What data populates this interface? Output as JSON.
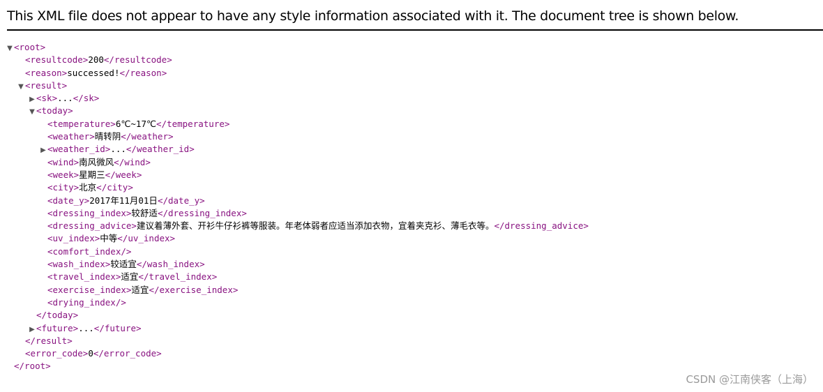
{
  "header": {
    "notice": "This XML file does not appear to have any style information associated with it. The document tree is shown below."
  },
  "tree": {
    "lines": [
      {
        "depth": 0,
        "toggle": "expanded",
        "open": "<root>",
        "value": "",
        "close": ""
      },
      {
        "depth": 1,
        "toggle": "",
        "open": "<resultcode>",
        "value": "200",
        "close": "</resultcode>"
      },
      {
        "depth": 1,
        "toggle": "",
        "open": "<reason>",
        "value": "successed!",
        "close": "</reason>"
      },
      {
        "depth": 1,
        "toggle": "expanded",
        "open": "<result>",
        "value": "",
        "close": ""
      },
      {
        "depth": 2,
        "toggle": "collapsed",
        "open": "<sk>",
        "value": "...",
        "close": "</sk>"
      },
      {
        "depth": 2,
        "toggle": "expanded",
        "open": "<today>",
        "value": "",
        "close": ""
      },
      {
        "depth": 3,
        "toggle": "",
        "open": "<temperature>",
        "value": "6℃~17℃",
        "close": "</temperature>"
      },
      {
        "depth": 3,
        "toggle": "",
        "open": "<weather>",
        "value": "晴转阴",
        "close": "</weather>"
      },
      {
        "depth": 3,
        "toggle": "collapsed",
        "open": "<weather_id>",
        "value": "...",
        "close": "</weather_id>"
      },
      {
        "depth": 3,
        "toggle": "",
        "open": "<wind>",
        "value": "南风微风",
        "close": "</wind>"
      },
      {
        "depth": 3,
        "toggle": "",
        "open": "<week>",
        "value": "星期三",
        "close": "</week>"
      },
      {
        "depth": 3,
        "toggle": "",
        "open": "<city>",
        "value": "北京",
        "close": "</city>"
      },
      {
        "depth": 3,
        "toggle": "",
        "open": "<date_y>",
        "value": "2017年11月01日",
        "close": "</date_y>"
      },
      {
        "depth": 3,
        "toggle": "",
        "open": "<dressing_index>",
        "value": "较舒适",
        "close": "</dressing_index>"
      },
      {
        "depth": 3,
        "toggle": "",
        "open": "<dressing_advice>",
        "value": "建议着薄外套、开衫牛仔衫裤等服装。年老体弱者应适当添加衣物，宜着夹克衫、薄毛衣等。",
        "close": "</dressing_advice>"
      },
      {
        "depth": 3,
        "toggle": "",
        "open": "<uv_index>",
        "value": "中等",
        "close": "</uv_index>"
      },
      {
        "depth": 3,
        "toggle": "",
        "open": "<comfort_index/>",
        "value": "",
        "close": ""
      },
      {
        "depth": 3,
        "toggle": "",
        "open": "<wash_index>",
        "value": "较适宜",
        "close": "</wash_index>"
      },
      {
        "depth": 3,
        "toggle": "",
        "open": "<travel_index>",
        "value": "适宜",
        "close": "</travel_index>"
      },
      {
        "depth": 3,
        "toggle": "",
        "open": "<exercise_index>",
        "value": "适宜",
        "close": "</exercise_index>"
      },
      {
        "depth": 3,
        "toggle": "",
        "open": "<drying_index/>",
        "value": "",
        "close": ""
      },
      {
        "depth": 2,
        "toggle": "",
        "open": "</today>",
        "value": "",
        "close": ""
      },
      {
        "depth": 2,
        "toggle": "collapsed",
        "open": "<future>",
        "value": "...",
        "close": "</future>"
      },
      {
        "depth": 1,
        "toggle": "",
        "open": "</result>",
        "value": "",
        "close": ""
      },
      {
        "depth": 1,
        "toggle": "",
        "open": "<error_code>",
        "value": "0",
        "close": "</error_code>"
      },
      {
        "depth": 0,
        "toggle": "",
        "open": "</root>",
        "value": "",
        "close": ""
      }
    ],
    "toggle_glyphs": {
      "expanded": "▼",
      "collapsed": "▶"
    }
  },
  "watermark": {
    "text": "CSDN @江南侠客（上海）"
  },
  "colors": {
    "tag": "#881280",
    "text": "#000000",
    "toggle": "#555555",
    "watermark": "#9a9a9a"
  }
}
